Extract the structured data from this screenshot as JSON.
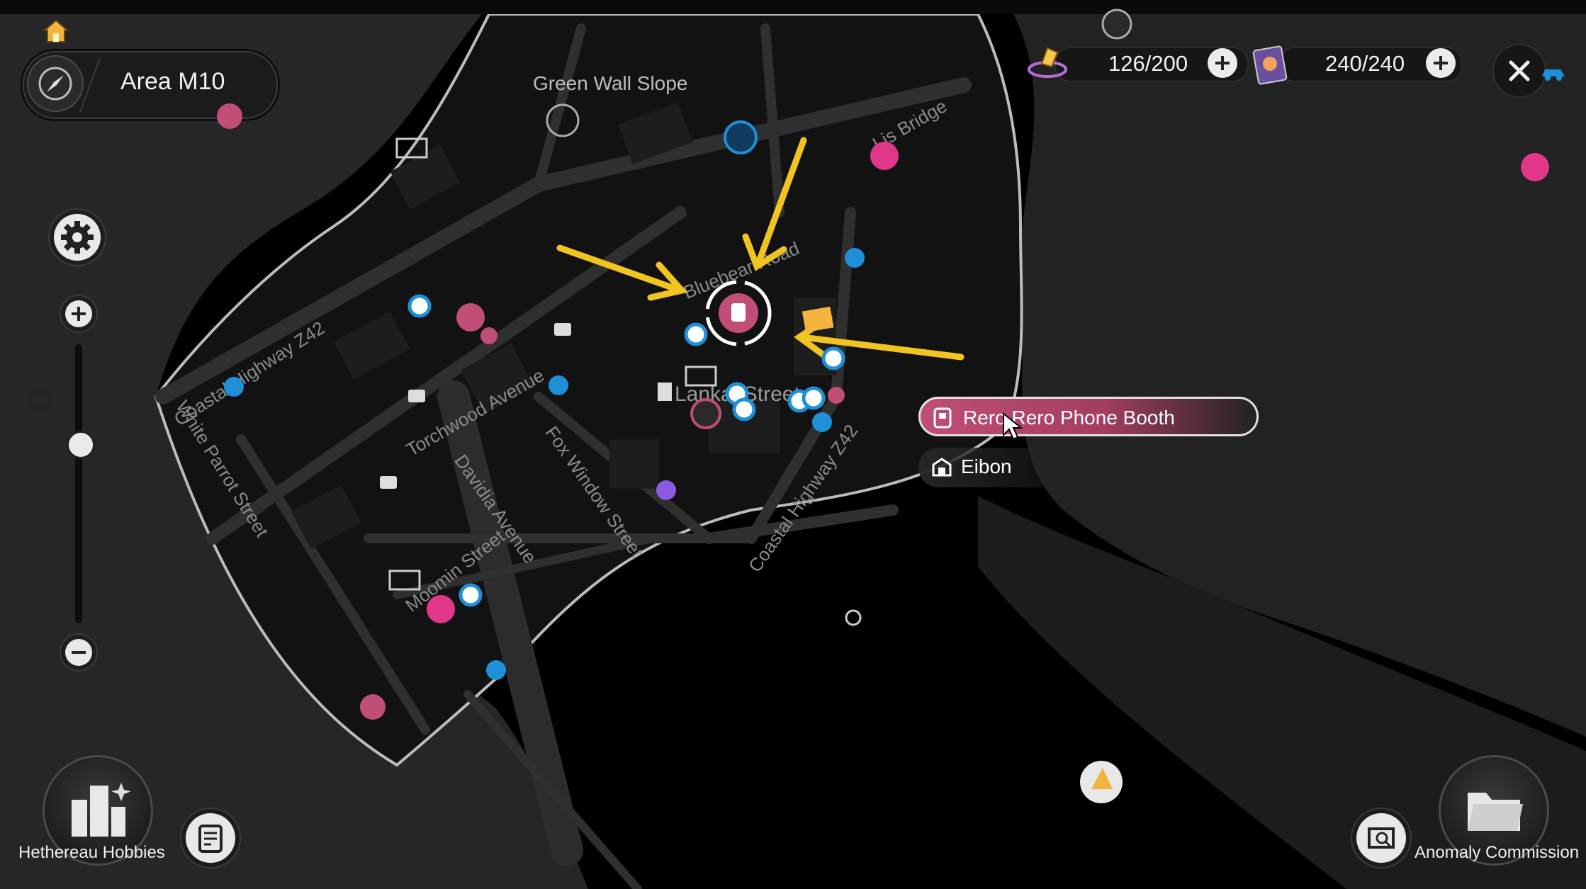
{
  "header": {
    "area_label": "Area M10"
  },
  "resources": [
    {
      "name": "battery-charge",
      "value": "126/200",
      "color": "#f5c84b"
    },
    {
      "name": "film-tickets",
      "value": "240/240",
      "color": "#9b7bd6"
    }
  ],
  "map": {
    "place_label": "Green Wall Slope",
    "streets": {
      "coastal_west": "Coastal Highway Z42",
      "white_parrot": "White Parrot Street",
      "torchwood": "Torchwood Avenue",
      "davidia": "Davidia Avenue",
      "fox_window": "Fox Window Street",
      "coastal_east": "Coastal Highway Z42",
      "moomin": "Moomin Street",
      "bluebear": "Bluebear Road",
      "lankai": "Lankai Street",
      "bridge": "Lis Bridge"
    }
  },
  "location_list": [
    {
      "label": "Rero Rero Phone Booth",
      "icon": "phone-booth-icon",
      "selected": true
    },
    {
      "label": "Eibon",
      "icon": "shop-icon",
      "selected": false
    }
  ],
  "bottom": {
    "left_label": "Hethereau Hobbies",
    "right_label": "Anomaly Commission"
  },
  "colors": {
    "accent_pink": "#c14d79",
    "marker_blue": "#1f8fd8",
    "arrow_yellow": "#f2c420"
  }
}
